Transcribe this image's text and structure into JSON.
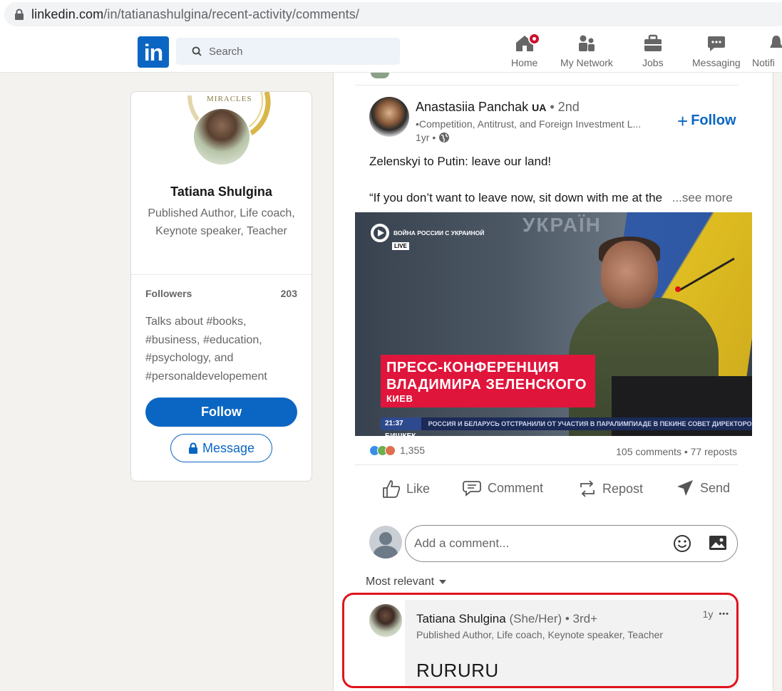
{
  "browser": {
    "url_domain": "linkedin.com",
    "url_path": "/in/tatianashulgina/recent-activity/comments/"
  },
  "nav": {
    "logo_text": "in",
    "search_placeholder": "Search",
    "items": [
      {
        "label": "Home",
        "icon": "home-icon"
      },
      {
        "label": "My Network",
        "icon": "network-icon"
      },
      {
        "label": "Jobs",
        "icon": "briefcase-icon"
      },
      {
        "label": "Messaging",
        "icon": "messaging-icon"
      },
      {
        "label": "Notifi",
        "icon": "bell-icon"
      }
    ],
    "accent": "#0a66c2",
    "badge_color": "#cb112d"
  },
  "profile": {
    "cover_text": "MIRACLES",
    "name": "Tatiana Shulgina",
    "headline": "Published Author, Life coach, Keynote speaker, Teacher",
    "followers_label": "Followers",
    "followers_count": "203",
    "talks_about": "Talks about #books, #business, #education, #psychology, and #personaldevelopement",
    "follow_button": "Follow",
    "message_button": "Message"
  },
  "post": {
    "author": "Anastasiia Panchak",
    "author_badge": "UA",
    "degree": "• 2nd",
    "subtitle": "•Competition, Antitrust, and Foreign Investment L...",
    "time": "1yr •",
    "follow_label": "Follow",
    "text_line1": "Zelenskyi to Putin: leave our land!",
    "text_line2": "“If you don’t want to leave now, sit down with me at the",
    "see_more": "...see more",
    "video": {
      "channel": "ВОЙНА РОССИИ С УКРАИНОЙ",
      "live": "LIVE",
      "wall_text": "УКРАЇН",
      "caption_line1": "ПРЕСС-КОНФЕРЕНЦИЯ",
      "caption_line2": "ВЛАДИМИРА ЗЕЛЕНСКОГО",
      "caption_city": "КИЕВ",
      "ticker_time": "21:37 БИШКЕК",
      "ticker_text": "РОССИЯ И БЕЛАРУСЬ ОТСТРАНИЛИ ОТ УЧАСТИЯ В ПАРАЛИМПИАДЕ В ПЕКИНЕ  СОВЕТ ДИРЕКТОРОВ ЛИКВИДИРОВАЛ «ЭХО МОСКВЫ» И САЙТ РАДИОСТАНЦИИ"
    },
    "reactions_count": "1,355",
    "comments_reposts": "105 comments • 77 reposts",
    "actions": [
      "Like",
      "Comment",
      "Repost",
      "Send"
    ]
  },
  "comment_input": {
    "placeholder": "Add a comment..."
  },
  "sort_label": "Most relevant",
  "comment": {
    "name": "Tatiana Shulgina",
    "pronouns": "(She/Her)",
    "degree": "• 3rd+",
    "headline": "Published Author, Life coach, Keynote speaker, Teacher",
    "time": "1y",
    "more": "•••",
    "text": "RURURU"
  }
}
